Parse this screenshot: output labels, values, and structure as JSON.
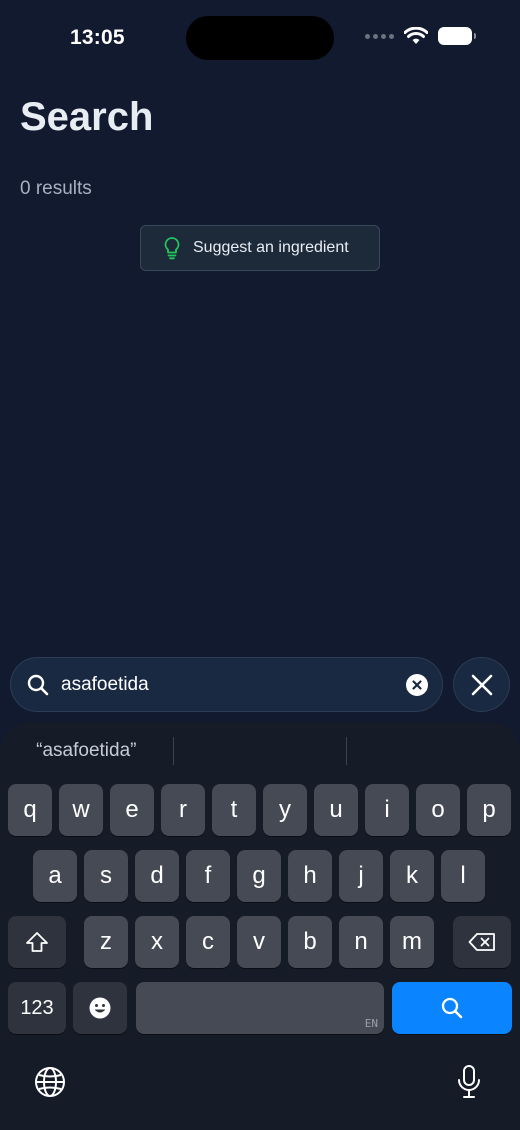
{
  "status_bar": {
    "time": "13:05"
  },
  "header": {
    "title": "Search",
    "results": "0 results"
  },
  "suggest": {
    "label": "Suggest an ingredient",
    "icon": "lightbulb-icon",
    "icon_color": "#22c55e"
  },
  "search": {
    "query": "asafoetida"
  },
  "keyboard": {
    "suggestions": [
      "“asafoetida”",
      "",
      ""
    ],
    "row1": [
      "q",
      "w",
      "e",
      "r",
      "t",
      "y",
      "u",
      "i",
      "o",
      "p"
    ],
    "row2": [
      "a",
      "s",
      "d",
      "f",
      "g",
      "h",
      "j",
      "k",
      "l"
    ],
    "row3": [
      "z",
      "x",
      "c",
      "v",
      "b",
      "n",
      "m"
    ],
    "numbers_key": "123",
    "space_lang": "EN",
    "search_key_color": "#0a84ff"
  }
}
